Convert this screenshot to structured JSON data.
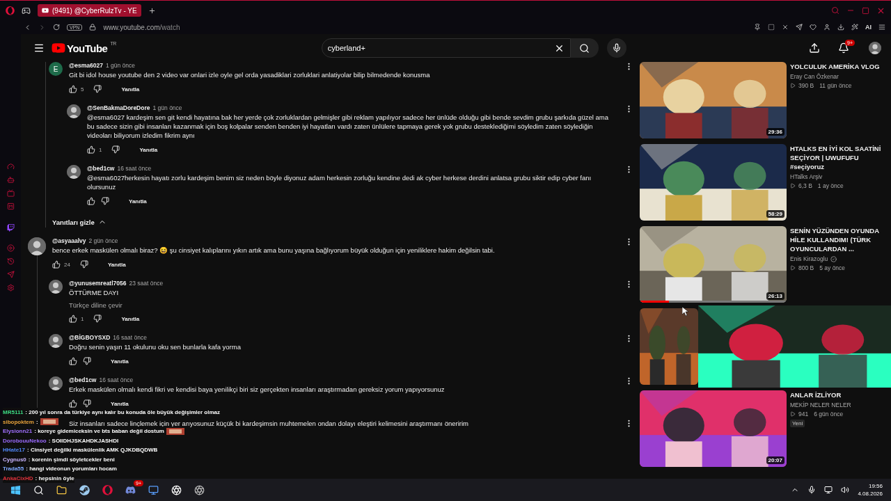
{
  "browser": {
    "tab_title": "(9491) @CyberRulzTv - YE",
    "vpn_label": "VPN",
    "url_host": "www.youtube.com",
    "url_path": "/watch",
    "ai_label": "AI"
  },
  "youtube": {
    "logo_text": "YouTube",
    "region": "TR",
    "search_value": "cyberland+",
    "notification_count": "9+"
  },
  "sections": [
    {
      "kind": "reply_thread",
      "replies": [
        {
          "author": "@esma6027",
          "time": "1 gün önce",
          "avatar_letter": "E",
          "text": "Git bi idol house youtube den 2 video var onlari izle oyle gel orda yasadiklari zorluklari anlatiyolar bilip bilmedende konusma",
          "likes": "5",
          "reply_label": "Yanıtla",
          "children": [
            {
              "author": "@SenBakmaDoreDore",
              "time": "1 gün önce",
              "text": "@esma6027 kardeşim sen git kendi hayatına bak her yerde çok zorluklardan gelmişler gibi reklam yapılıyor sadece her ünlüde olduğu gibi bende sevdim grubu şarkıda güzel ama bu sadece sizin gibi insanları kazanmak için boş kolpalar senden benden iyi hayatları vardı zaten ünlülere tapmaya gerek yok grubu desteklediğimi söyledim zaten söylediğin videoları biliyorum izledim fikrim aynı",
              "likes": "1",
              "reply_label": "Yanıtla"
            },
            {
              "author": "@bed1cw",
              "time": "16 saat önce",
              "text": "@esma6027herkesin hayatı zorlu kardeşim benim siz neden böyle diyonuz adam herkesin zorluğu kendine dedi ak cyber herkese derdini anlatsa grubu siktir edip cyber fanı olursunuz",
              "reply_label": "Yanıtla"
            }
          ]
        }
      ],
      "toggle_label": "Yanıtları gizle"
    },
    {
      "kind": "comment",
      "comment": {
        "author": "@asyaaalvy",
        "time": "2 gün önce",
        "text": "bence erkek maskülen olmalı biraz? 😆 şu cinsiyet kalıplarını yıkın artık ama bunu yaşına bağlıyorum büyük olduğun için yeniliklere hakim değilsin tabi.",
        "likes": "24",
        "reply_label": "Yanıtla",
        "children": [
          {
            "author": "@yunusemreatl7056",
            "time": "23 saat önce",
            "text": "ÖTTÜRME DAYI",
            "translate": "Türkçe diline çevir",
            "likes": "1",
            "reply_label": "Yanıtla"
          },
          {
            "author": "@BİGBOYSXD",
            "time": "16 saat önce",
            "text": "Doğru senin yaşın 11 okulunu oku sen bunlarla kafa yorma",
            "reply_label": "Yanıtla"
          },
          {
            "author": "@bed1cw",
            "time": "16 saat önce",
            "text": "Erkek maskülen olmalı kendi fikri ve kendisi baya yenilikçi biri siz gerçekten insanları araştırmadan gereksiz yorum yapıyorsunuz",
            "reply_label": "Yanıtla"
          },
          {
            "text": "Siz insanları sadece linçlemek için yer arıyosunuz küçük bi kardeşimsin muhtemelen ondan dolayı eleştiri kelimesini araştırmanı öneririm"
          }
        ]
      }
    }
  ],
  "recommended": [
    {
      "kind": "video",
      "title": "YOLCULUK AMERİKA VLOG",
      "channel": "Eray Can Özkenar",
      "views": "390 B",
      "age": "11 gün önce",
      "duration": "29:36"
    },
    {
      "kind": "video",
      "title": "HTALKS EN İYİ KOL SAATİNİ SEÇİYOR | UWUFUFU #seçiyoruz",
      "channel": "HTalks Arşiv",
      "views": "6,3 B",
      "age": "1 ay önce",
      "duration": "58:29"
    },
    {
      "kind": "video",
      "title": "SENİN YÜZÜNDEN OYUNDA HİLE KULLANDIM! (TÜRK OYUNCULARDAN ...",
      "channel": "Enis Kirazoglu",
      "verified": true,
      "views": "800 B",
      "age": "5 ay önce",
      "duration": "26:13",
      "level": 0.2
    },
    {
      "kind": "picture"
    },
    {
      "kind": "video",
      "title": "ANLAR İZLİYOR",
      "channel": "MEKİP NELER NELER",
      "views": "941",
      "age": "6 gün önce",
      "badge": "Yeni",
      "duration": "20:07"
    }
  ],
  "chat": [
    {
      "user": "MR5111",
      "color": "#3ddc84",
      "message": ": 200 yıl sonra da türkiye aynı kalır bu konuda öle büyük değişimler olmaz"
    },
    {
      "user": "sibopoktem",
      "color": "#e8a23a",
      "message": ":",
      "emote": true
    },
    {
      "user": "Elysionn21",
      "color": "#a070ff",
      "message": ": koreye gidemiceksin ve bts baban değil dostum",
      "emote": true
    },
    {
      "user": "DorobouuNekoo",
      "color": "#9b6bff",
      "message": ": SOIIDHJSKAHDKJASHDI"
    },
    {
      "user": "HHate17",
      "color": "#4f86f7",
      "message": ": Cinsiyet değilki maskülenlik AMK QJKDBQDWB"
    },
    {
      "user": "Cygnus0",
      "color": "#c8b4ff",
      "message": ": korenin şimdi söyletcekler beni"
    },
    {
      "user": "Trada55",
      "color": "#7fa8ff",
      "message": ": hangi videonun yorumları hocam"
    },
    {
      "user": "AnkaCixHD",
      "color": "#e0323c",
      "message": ": hepsinin öyle"
    }
  ],
  "taskbar": {
    "discord_badge": "9+",
    "time": "19:56",
    "date": "4.08.2026"
  }
}
